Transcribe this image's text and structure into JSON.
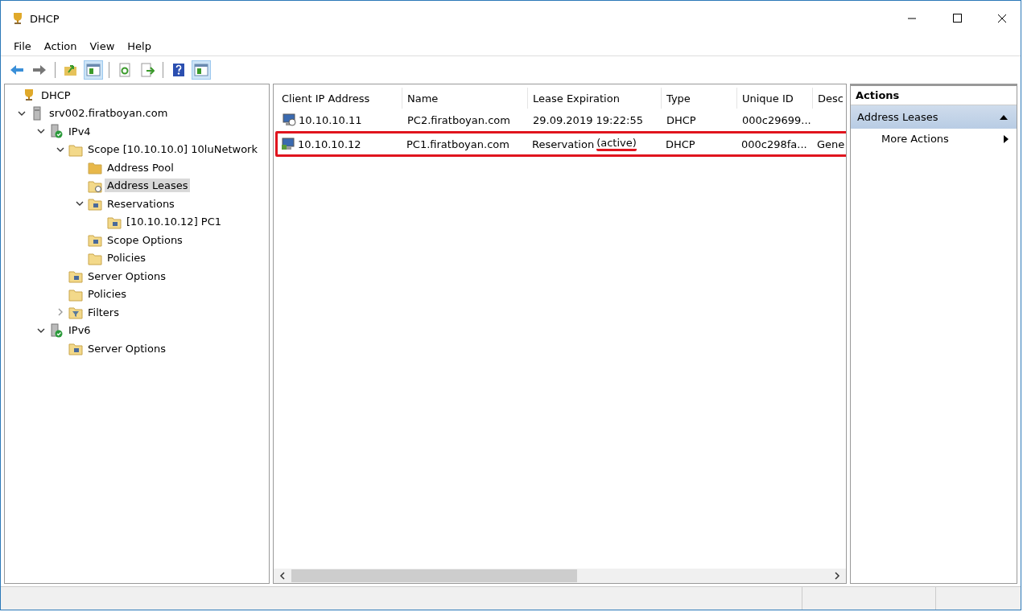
{
  "window": {
    "title": "DHCP"
  },
  "menu": [
    "File",
    "Action",
    "View",
    "Help"
  ],
  "toolbar": [
    {
      "kind": "back",
      "pressed": false
    },
    {
      "kind": "forward",
      "pressed": false
    },
    {
      "kind": "sep"
    },
    {
      "kind": "up",
      "pressed": false
    },
    {
      "kind": "pane",
      "pressed": true
    },
    {
      "kind": "sep"
    },
    {
      "kind": "refresh",
      "pressed": false
    },
    {
      "kind": "export",
      "pressed": false
    },
    {
      "kind": "sep"
    },
    {
      "kind": "help",
      "pressed": false
    },
    {
      "kind": "pane2",
      "pressed": true
    }
  ],
  "tree": [
    {
      "label": "DHCP",
      "kind": "root",
      "selected": false,
      "children": [
        {
          "label": "srv002.firatboyan.com",
          "kind": "server",
          "selected": false,
          "expanded": true,
          "children": [
            {
              "label": "IPv4",
              "kind": "proto",
              "selected": false,
              "expanded": true,
              "children": [
                {
                  "label": "Scope [10.10.10.0] 10luNetwork",
                  "kind": "folder",
                  "selected": false,
                  "expanded": true,
                  "children": [
                    {
                      "label": "Address Pool",
                      "kind": "pool",
                      "selected": false
                    },
                    {
                      "label": "Address Leases",
                      "kind": "leases",
                      "selected": true
                    },
                    {
                      "label": "Reservations",
                      "kind": "res",
                      "selected": false,
                      "expanded": true,
                      "children": [
                        {
                          "label": "[10.10.10.12] PC1",
                          "kind": "resitem",
                          "selected": false
                        }
                      ]
                    },
                    {
                      "label": "Scope Options",
                      "kind": "options",
                      "selected": false
                    },
                    {
                      "label": "Policies",
                      "kind": "policy",
                      "selected": false
                    }
                  ]
                },
                {
                  "label": "Server Options",
                  "kind": "options",
                  "selected": false
                },
                {
                  "label": "Policies",
                  "kind": "policy",
                  "selected": false
                },
                {
                  "label": "Filters",
                  "kind": "filter",
                  "selected": false,
                  "expanded": false
                }
              ]
            },
            {
              "label": "IPv6",
              "kind": "proto",
              "selected": false,
              "expanded": true,
              "children": [
                {
                  "label": "Server Options",
                  "kind": "options",
                  "selected": false
                }
              ]
            }
          ]
        }
      ]
    }
  ],
  "table": {
    "columns": [
      "Client IP Address",
      "Name",
      "Lease Expiration",
      "Type",
      "Unique ID",
      "Desc"
    ],
    "rows": [
      {
        "kind": "lease",
        "highlighted": false,
        "ip": "10.10.10.11",
        "name": "PC2.firatboyan.com",
        "lease": "29.09.2019 19:22:55",
        "type": "DHCP",
        "uid": "000c29699...",
        "desc": ""
      },
      {
        "kind": "reservation",
        "highlighted": true,
        "ip": "10.10.10.12",
        "name": "PC1.firatboyan.com",
        "lease": "Reservation",
        "lease_note": "(active)",
        "type": "DHCP",
        "uid": "000c298fa...",
        "desc": "Gene"
      }
    ]
  },
  "actions": {
    "title": "Actions",
    "section": {
      "label": "Address Leases",
      "expanded": true
    },
    "items": [
      "More Actions"
    ]
  }
}
